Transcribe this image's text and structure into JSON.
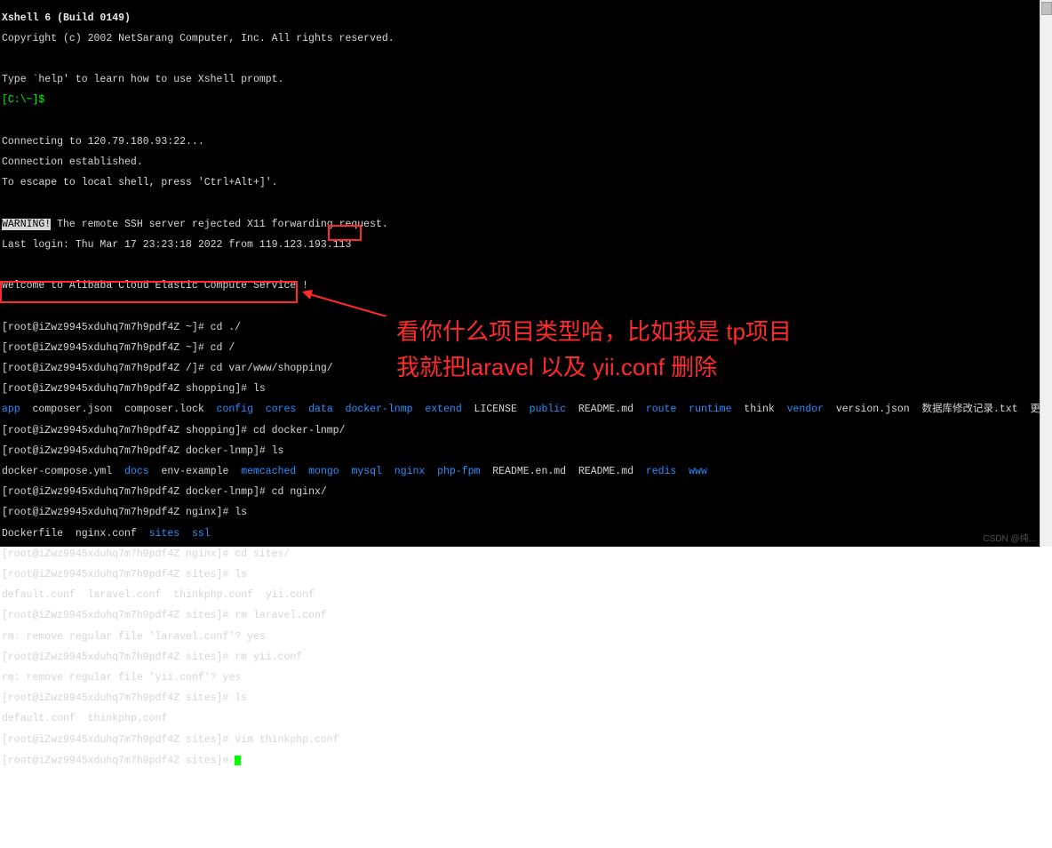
{
  "header": {
    "title": "Xshell 6 (Build 0149)",
    "copyright": "Copyright (c) 2002 NetSarang Computer, Inc. All rights reserved.",
    "help": "Type `help' to learn how to use Xshell prompt.",
    "local_prompt": "[C:\\~]$"
  },
  "connect": {
    "line1": "Connecting to 120.79.180.93:22...",
    "line2": "Connection established.",
    "line3": "To escape to local shell, press 'Ctrl+Alt+]'."
  },
  "warning": {
    "label": "WARNING!",
    "msg": " The remote SSH server rejected X11 forwarding request.",
    "last_login": "Last login: Thu Mar 17 23:23:18 2022 from 119.123.193.113",
    "welcome": "Welcome to Alibaba Cloud Elastic Compute Service !"
  },
  "prompts": {
    "home": "[root@iZwz9945xduhq7m7h9pdf4Z ~]# ",
    "root": "[root@iZwz9945xduhq7m7h9pdf4Z /]# ",
    "shopping": "[root@iZwz9945xduhq7m7h9pdf4Z shopping]# ",
    "dockerlnmp": "[root@iZwz9945xduhq7m7h9pdf4Z docker-lnmp]# ",
    "nginx": "[root@iZwz9945xduhq7m7h9pdf4Z nginx]# ",
    "sites": "[root@iZwz9945xduhq7m7h9pdf4Z sites]# "
  },
  "cmds": {
    "cd_dot": "cd ./",
    "cd_root": "cd /",
    "cd_shopping": "cd var/www/shopping/",
    "ls": "ls",
    "cd_dockerlnmp": "cd docker-lnmp/",
    "cd_nginx": "cd nginx/",
    "cd_sites": "cd sites/",
    "rm_laravel": "rm laravel.conf",
    "rm_yii": "rm yii.conf",
    "vim_tp": "vim thinkphp.conf",
    "yes": "yes"
  },
  "rm": {
    "q1": "rm: remove regular file 'laravel.conf'? ",
    "q2": "rm: remove regular file 'yii.conf'? "
  },
  "listing_shopping": {
    "app": "app",
    "composer_json": "composer.json",
    "composer_lock": "composer.lock",
    "config": "config",
    "cores": "cores",
    "data": "data",
    "docker_lnmp": "docker-lnmp",
    "extend": "extend",
    "license": "LICENSE",
    "public": "public",
    "readme": "README.md",
    "route": "route",
    "runtime": "runtime",
    "think": "think",
    "vendor": "vendor",
    "version": "version.json",
    "db_log": "数据库修改记录.txt",
    "update_log": "更新日志.txt"
  },
  "listing_dockerlnmp": {
    "compose": "docker-compose.yml",
    "docs": "docs",
    "env": "env-example",
    "memcached": "memcached",
    "mongo": "mongo",
    "mysql": "mysql",
    "nginx": "nginx",
    "phpfpm": "php-fpm",
    "readme_en": "README.en.md",
    "readme": "README.md",
    "redis": "redis",
    "www": "www"
  },
  "listing_nginx": {
    "dockerfile": "Dockerfile",
    "nginxconf": "nginx.conf",
    "sites": "sites",
    "ssl": "ssl"
  },
  "listing_sites1": {
    "default": "default.conf",
    "laravel": "laravel.conf",
    "thinkphp": "thinkphp.conf",
    "yii": "yii.conf"
  },
  "listing_sites2": {
    "default": "default.conf",
    "thinkphp": "thinkphp.conf"
  },
  "annotation": {
    "line1": "看你什么项目类型哈，比如我是 tp项目",
    "line2": "我就把laravel 以及 yii.conf 删除"
  },
  "watermark": "CSDN @纯..."
}
